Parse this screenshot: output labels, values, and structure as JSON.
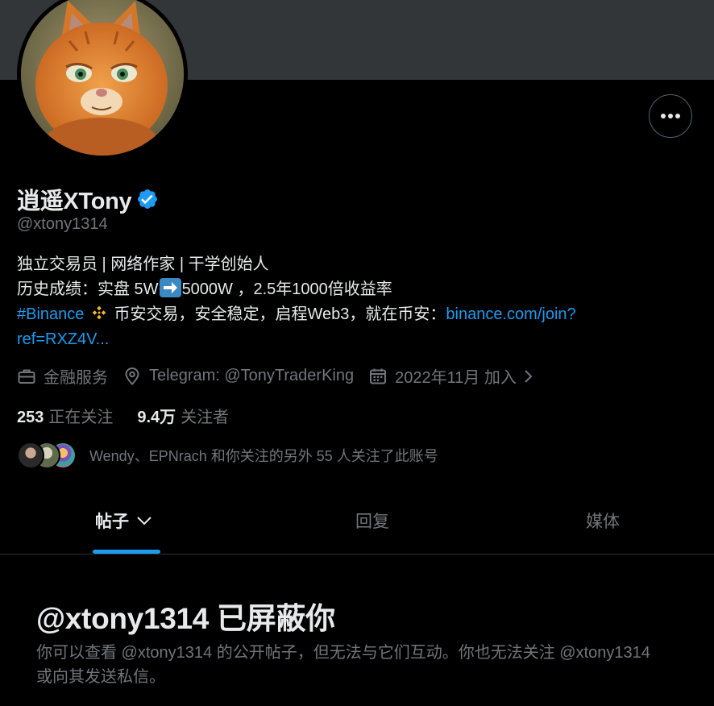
{
  "profile": {
    "display_name": "逍遥XTony",
    "handle": "@xtony1314",
    "bio": {
      "line1": "独立交易员 | 网络作家 | 干学创始人",
      "line2_before": "历史成绩：实盘 5W",
      "line2_after": "5000W ，2.5年1000倍收益率",
      "line3_hashtag": "#Binance",
      "line3_text": " 币安交易，安全稳定，启程Web3，就在币安：",
      "line3_link": "binance.com/join?",
      "line4_link": "ref=RXZ4V..."
    },
    "meta": {
      "category": "金融服务",
      "location": "Telegram: @TonyTraderKing",
      "joined": "2022年11月 加入"
    },
    "following_count": "253",
    "following_label": "正在关注",
    "followers_count": "9.4万",
    "followers_label": "关注者",
    "followers_you_know": "Wendy、EPNrach 和你关注的另外 55 人关注了此账号"
  },
  "tabs": [
    {
      "label": "帖子"
    },
    {
      "label": "回复"
    },
    {
      "label": "媒体"
    }
  ],
  "blocked": {
    "title": "@xtony1314 已屏蔽你",
    "description": "你可以查看 @xtony1314 的公开帖子，但无法与它们互动。你也无法关注 @xtony1314 或向其发送私信。"
  },
  "colors": {
    "background": "#000000",
    "banner": "#333639",
    "accent": "#1d9bf0",
    "text_primary": "#e7e9ea",
    "text_secondary": "#71767b"
  },
  "icons": {
    "verified": "verified-badge-icon",
    "more": "more-dots-icon",
    "category": "briefcase-icon",
    "location": "location-pin-icon",
    "joined": "calendar-icon"
  }
}
